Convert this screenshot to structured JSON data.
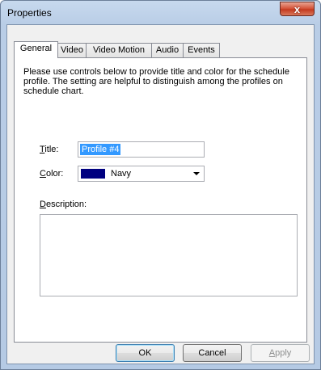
{
  "window": {
    "title": "Properties",
    "close_glyph": "x"
  },
  "tabs": [
    {
      "label": "General"
    },
    {
      "label": "Video"
    },
    {
      "label": "Video Motion"
    },
    {
      "label": "Audio"
    },
    {
      "label": "Events"
    }
  ],
  "general": {
    "description_line1": "Please use controls below to provide title and color for the schedule",
    "description_line2": "profile. The setting are helpful to distinguish among the profiles on",
    "description_line3": "schedule chart.",
    "title_label_u": "T",
    "title_label_rest": "itle:",
    "title_value": "Profile #4",
    "color_label_u": "C",
    "color_label_rest": "olor:",
    "color_value": "Navy",
    "color_swatch": "#000080",
    "description_label_u": "D",
    "description_label_rest": "escription:",
    "description_value": ""
  },
  "buttons": {
    "ok": "OK",
    "cancel": "Cancel",
    "apply_u": "A",
    "apply_rest": "pply"
  }
}
